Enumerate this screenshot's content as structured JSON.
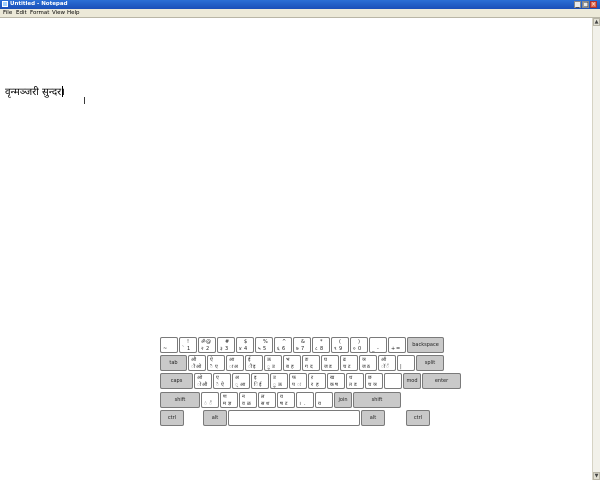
{
  "window": {
    "title": "Untitled - Notepad",
    "minimize": "_",
    "maximize": "□",
    "close": "×"
  },
  "menu": [
    {
      "label": "File"
    },
    {
      "label": "Edit"
    },
    {
      "label": "Format"
    },
    {
      "label": "View"
    },
    {
      "label": "Help"
    }
  ],
  "editor": {
    "text": "वृन्मञ्जरी सुन्दर।"
  },
  "keyboard": {
    "row1": [
      {
        "g": [
          "",
          "",
          "~",
          ""
        ]
      },
      {
        "g": [
          "",
          "!",
          "`",
          "1"
        ]
      },
      {
        "g": [
          "ॐ",
          "@",
          "२",
          "2"
        ]
      },
      {
        "g": [
          "",
          "#",
          "३",
          "3"
        ]
      },
      {
        "g": [
          "",
          "$",
          "४",
          "4"
        ]
      },
      {
        "g": [
          "",
          "%",
          "५",
          "5"
        ]
      },
      {
        "g": [
          "",
          "^",
          "६",
          "6"
        ]
      },
      {
        "g": [
          "",
          "&",
          "७",
          "7"
        ]
      },
      {
        "g": [
          "",
          "*",
          "८",
          "8"
        ]
      },
      {
        "g": [
          "",
          "(",
          "९",
          "9"
        ]
      },
      {
        "g": [
          "",
          ")",
          "०",
          "0"
        ]
      },
      {
        "g": [
          "",
          "",
          "_",
          "-"
        ]
      },
      {
        "g": [
          "",
          "",
          "+",
          "="
        ]
      },
      {
        "label": "backspace"
      }
    ],
    "row2": [
      {
        "label": "tab"
      },
      {
        "g": [
          "औ",
          "",
          "ौ",
          "ओ"
        ]
      },
      {
        "g": [
          "ऐ",
          "",
          "ै",
          "ए"
        ]
      },
      {
        "g": [
          "आ",
          "",
          "ा",
          "अ"
        ]
      },
      {
        "g": [
          "ई",
          "",
          "ी",
          "इ"
        ]
      },
      {
        "g": [
          "ऊ",
          "",
          "ू",
          "उ"
        ]
      },
      {
        "g": [
          "भ",
          "",
          "ब",
          "ह"
        ]
      },
      {
        "g": [
          "ङ",
          "",
          "ग",
          "द"
        ]
      },
      {
        "g": [
          "घ",
          "",
          "ज",
          "ड"
        ]
      },
      {
        "g": [
          "ढ",
          "",
          "च",
          "ट"
        ]
      },
      {
        "g": [
          "ञ",
          "",
          "ज",
          "ठ"
        ]
      },
      {
        "g": [
          "ऑ",
          "",
          "ॉ",
          "ॅ"
        ]
      },
      {
        "g": [
          "",
          "",
          "|",
          ""
        ]
      },
      {
        "label": "split"
      }
    ],
    "row3": [
      {
        "label": "caps"
      },
      {
        "g": [
          "ओ",
          "",
          "ो",
          "औ"
        ]
      },
      {
        "g": [
          "ए",
          "",
          "े",
          "ऐ"
        ]
      },
      {
        "g": [
          "अ",
          "",
          "्",
          "आ"
        ]
      },
      {
        "g": [
          "इ",
          "",
          "ि",
          "ई"
        ]
      },
      {
        "g": [
          "उ",
          "",
          "ु",
          "ऊ"
        ]
      },
      {
        "g": [
          "फ",
          "",
          "प",
          "ः"
        ]
      },
      {
        "g": [
          "ऱ",
          "",
          "र",
          "ह"
        ]
      },
      {
        "g": [
          "ख",
          "",
          "क",
          "ष"
        ]
      },
      {
        "g": [
          "थ",
          "",
          "त",
          "ड"
        ]
      },
      {
        "g": [
          "छ",
          "",
          "च",
          "ञ"
        ]
      },
      {
        "g": [
          "",
          "",
          "",
          ""
        ]
      },
      {
        "label": "mod"
      },
      {
        "label": "enter"
      }
    ],
    "row4": [
      {
        "label": "shift"
      },
      {
        "g": [
          "",
          "",
          "ं",
          "ँ"
        ]
      },
      {
        "g": [
          "ण",
          "",
          "म",
          "ज्ञ"
        ]
      },
      {
        "g": [
          "न",
          "",
          "व",
          "ळ"
        ]
      },
      {
        "g": [
          "ल",
          "",
          "स",
          "श"
        ]
      },
      {
        "g": [
          "य",
          "",
          "ष",
          "ट"
        ]
      },
      {
        "g": [
          "",
          "",
          "।",
          "."
        ]
      },
      {
        "g": [
          "",
          "",
          "य",
          ""
        ]
      },
      {
        "label": "join"
      },
      {
        "label": "shift"
      }
    ],
    "row5": [
      {
        "label": "ctrl"
      },
      {
        "label": "alt"
      },
      {
        "label": ""
      },
      {
        "label": "alt"
      },
      {
        "label": "ctrl"
      }
    ]
  }
}
